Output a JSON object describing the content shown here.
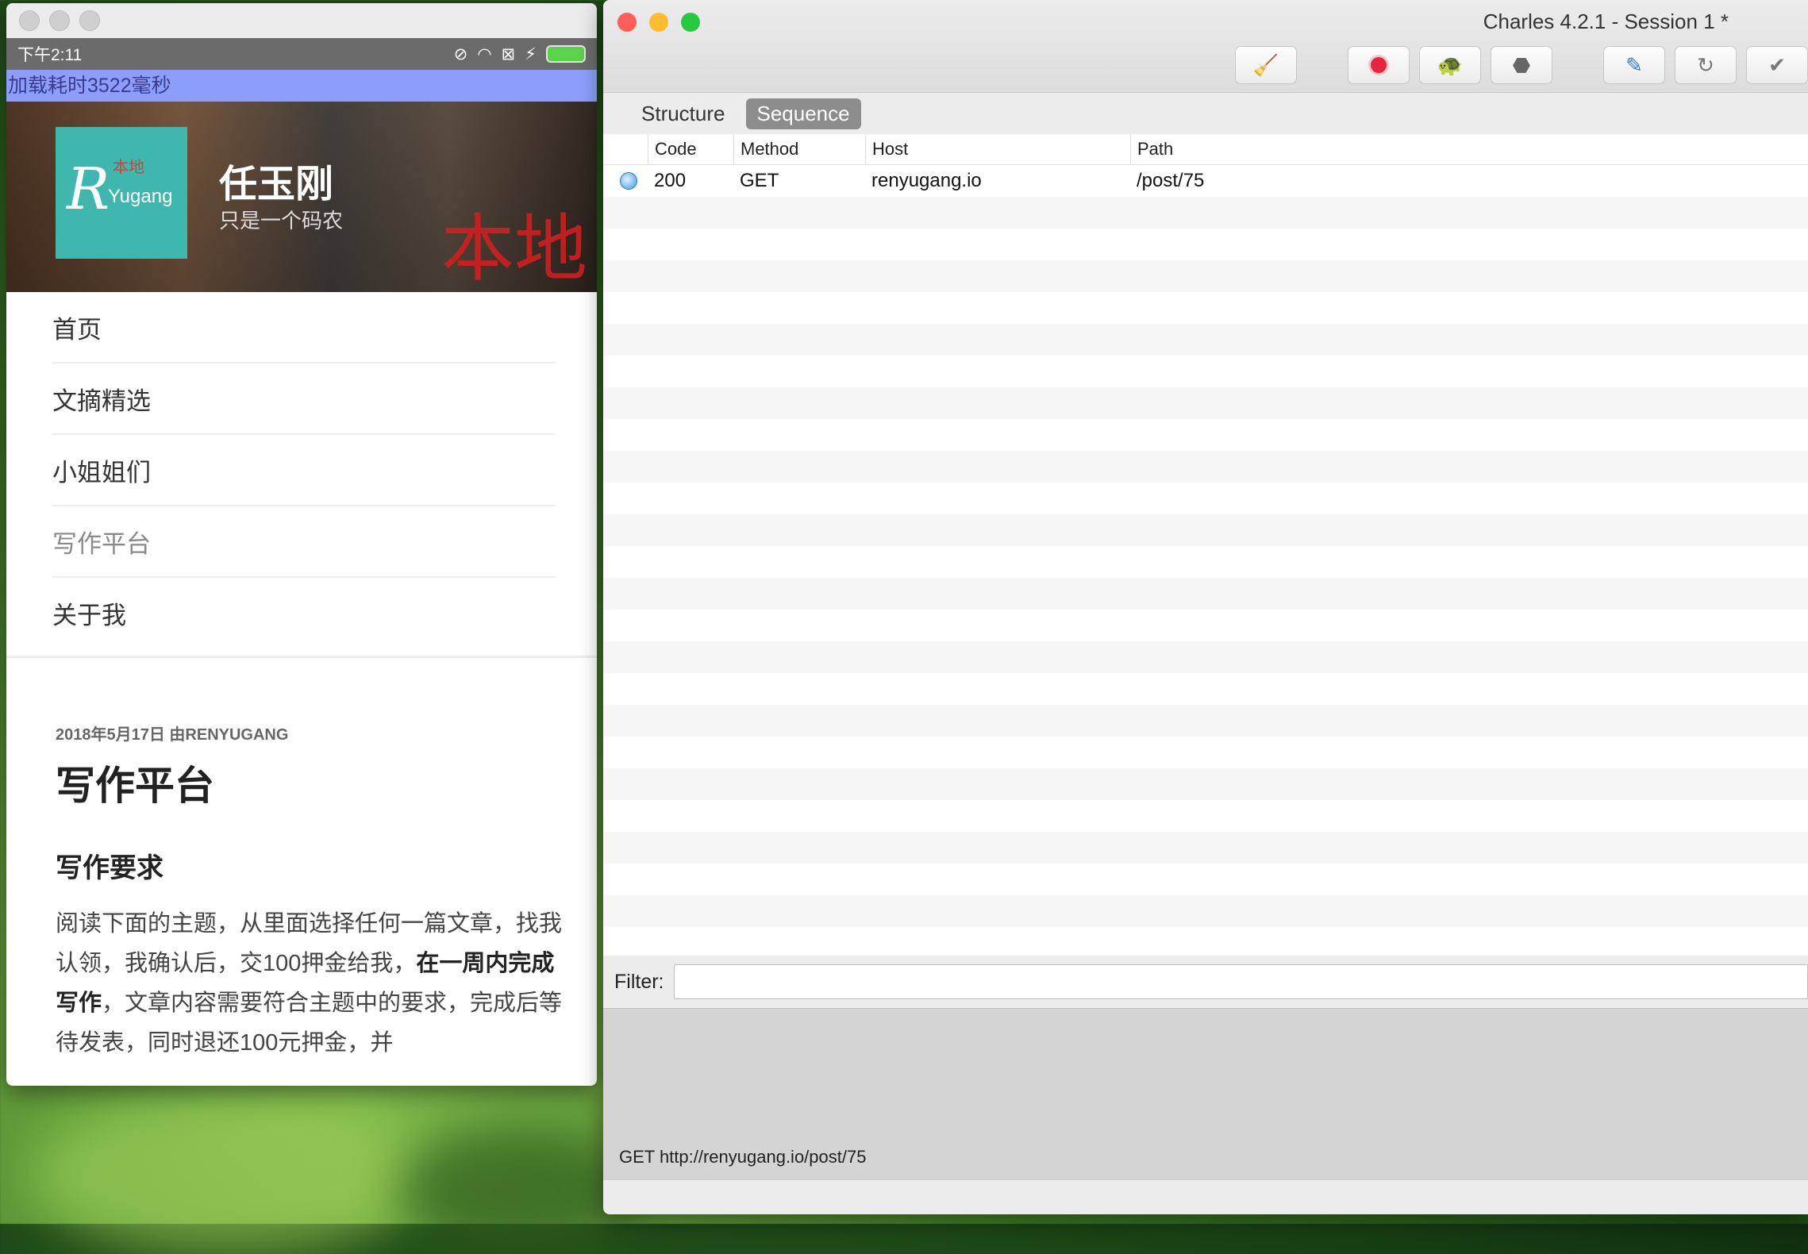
{
  "phone": {
    "status_time": "下午2:11",
    "toast": "加载耗时3522毫秒",
    "hero": {
      "logo_local": "本地",
      "logo_letter": "R",
      "logo_text": "Yugang",
      "name": "任玉刚",
      "subtitle": "只是一个码农",
      "watermark": "本地"
    },
    "nav": [
      "首页",
      "文摘精选",
      "小姐姐们",
      "写作平台",
      "关于我"
    ],
    "article": {
      "meta": "2018年5月17日 由RENYUGANG",
      "title": "写作平台",
      "subtitle": "写作要求",
      "para_1": "阅读下面的主题，从里面选择任何一篇文章，找我认领，我确认后，交100押金给我，",
      "para_bold": "在一周内完成写作",
      "para_2": "，文章内容需要符合主题中的要求，完成后等待发表，同时退还100元押金，并"
    }
  },
  "charles": {
    "title": "Charles 4.2.1 - Session 1 *",
    "tabs": [
      "Structure",
      "Sequence"
    ],
    "active_tab": "Sequence",
    "columns": [
      "Code",
      "Method",
      "Host",
      "Path"
    ],
    "rows": [
      {
        "code": "200",
        "method": "GET",
        "host": "renyugang.io",
        "path": "/post/75"
      }
    ],
    "filter_label": "Filter:",
    "filter_value": "",
    "status_line": "GET http://renyugang.io/post/75"
  },
  "toolbar_icons": [
    "broom-icon",
    "record-icon",
    "throttle-turtle-icon",
    "breakpoint-hexagon-icon",
    "compose-pen-icon",
    "repeat-icon",
    "validate-check-icon"
  ],
  "colors": {
    "close": "#fe5f57",
    "minimize": "#febc2e",
    "zoom": "#28c840",
    "record": "#e8253e",
    "toast_bg": "#8c9ef9",
    "logo_bg": "#3fb6ae"
  }
}
